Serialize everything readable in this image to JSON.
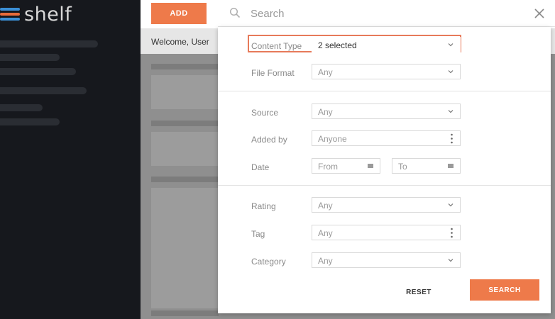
{
  "brand": {
    "logo_text": "shelf",
    "colors": {
      "accent": "#ee7a4a",
      "logo_blue": "#3b8fd6",
      "sidebar": "#16181d"
    }
  },
  "toolbar": {
    "add_label": "ADD"
  },
  "main": {
    "welcome": "Welcome, User"
  },
  "search": {
    "placeholder": "Search",
    "icon": "search-icon",
    "close_icon": "close-icon"
  },
  "filters": {
    "content_type": {
      "label": "Content Type",
      "value": "2 selected"
    },
    "file_format": {
      "label": "File Format",
      "value": "Any"
    },
    "source": {
      "label": "Source",
      "value": "Any"
    },
    "added_by": {
      "label": "Added by",
      "value": "Anyone"
    },
    "date": {
      "label": "Date",
      "from": "From",
      "to": "To"
    },
    "rating": {
      "label": "Rating",
      "value": "Any"
    },
    "tag": {
      "label": "Tag",
      "value": "Any"
    },
    "category": {
      "label": "Category",
      "value": "Any"
    }
  },
  "actions": {
    "reset": "RESET",
    "search": "SEARCH"
  }
}
